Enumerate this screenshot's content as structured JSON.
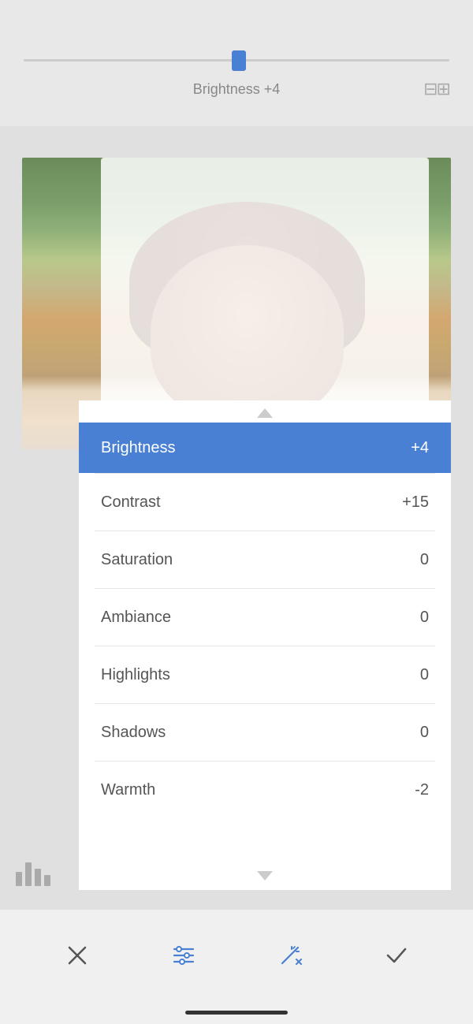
{
  "slider": {
    "label": "Brightness +4",
    "value": "+4",
    "name": "Brightness"
  },
  "compare_icon": "⊞",
  "adjustments": [
    {
      "name": "Brightness",
      "value": "+4",
      "active": true
    },
    {
      "name": "Contrast",
      "value": "+15",
      "active": false
    },
    {
      "name": "Saturation",
      "value": "0",
      "active": false
    },
    {
      "name": "Ambiance",
      "value": "0",
      "active": false
    },
    {
      "name": "Highlights",
      "value": "0",
      "active": false
    },
    {
      "name": "Shadows",
      "value": "0",
      "active": false
    },
    {
      "name": "Warmth",
      "value": "-2",
      "active": false
    }
  ],
  "toolbar": {
    "cancel_label": "✕",
    "confirm_label": "✓"
  }
}
